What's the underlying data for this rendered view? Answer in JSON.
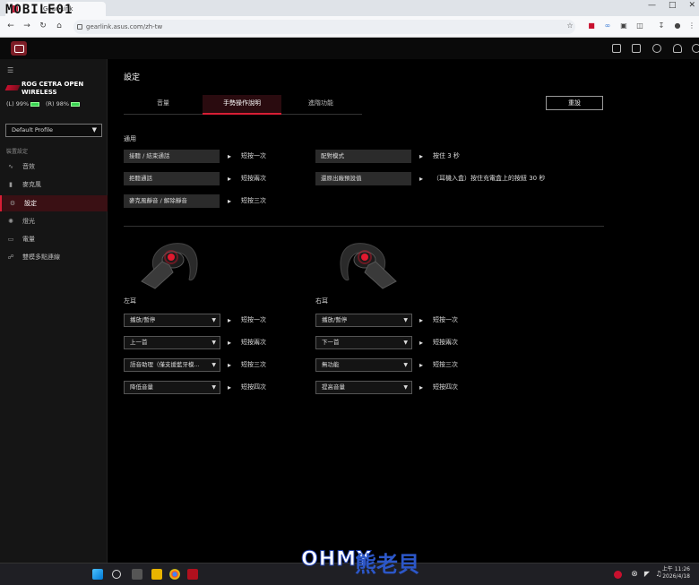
{
  "browser": {
    "tab_title": "Gear Link",
    "watermark": "MOBILE01",
    "url": "gearlink.asus.com/zh-tw"
  },
  "app": {
    "device_name": "ROG CETRA OPEN WIRELESS",
    "battery_left": "(L) 99%",
    "battery_right": "(R) 98%",
    "profile": "Default Profile",
    "sidebar_section": "裝置設定",
    "sidebar_items": [
      {
        "label": "音效",
        "icon": "sound-wave-icon"
      },
      {
        "label": "麥克風",
        "icon": "microphone-icon"
      },
      {
        "label": "設定",
        "icon": "gear-icon"
      },
      {
        "label": "燈光",
        "icon": "light-icon"
      },
      {
        "label": "電量",
        "icon": "battery-icon"
      },
      {
        "label": "雙模多點連線",
        "icon": "link-icon"
      }
    ]
  },
  "main": {
    "title": "設定",
    "tabs": [
      "音量",
      "手勢操作說明",
      "進階功能"
    ],
    "reset_label": "重設",
    "general": {
      "label": "通用",
      "left": [
        {
          "action": "接聽 / 結束通話",
          "gesture": "短按一次"
        },
        {
          "action": "拒聽通話",
          "gesture": "短按兩次"
        },
        {
          "action": "麥克風靜音 / 解除靜音",
          "gesture": "短按三次"
        }
      ],
      "right": [
        {
          "action": "配對模式",
          "gesture": "按住 3 秒"
        },
        {
          "action": "還原出廠預設值",
          "gesture": "（耳機入盒）按住充電盒上的按鈕 30 秒"
        }
      ]
    },
    "left_ear": {
      "label": "左耳",
      "rows": [
        {
          "value": "播放/暫停",
          "gesture": "短按一次"
        },
        {
          "value": "上一首",
          "gesture": "短按兩次"
        },
        {
          "value": "語音助理（僅支援藍牙模...",
          "gesture": "短按三次"
        },
        {
          "value": "降低音量",
          "gesture": "短按四次"
        }
      ]
    },
    "right_ear": {
      "label": "右耳",
      "rows": [
        {
          "value": "播放/暫停",
          "gesture": "短按一次"
        },
        {
          "value": "下一首",
          "gesture": "短按兩次"
        },
        {
          "value": "無功能",
          "gesture": "短按三次"
        },
        {
          "value": "提高音量",
          "gesture": "短按四次"
        }
      ]
    }
  },
  "taskbar": {
    "time": "上午 11:26",
    "date": "2026/4/18",
    "watermark_brand": "OHMY",
    "watermark_brand2": "熊老貝"
  },
  "colors": {
    "accent": "#d81e35",
    "battery": "#39d353"
  }
}
